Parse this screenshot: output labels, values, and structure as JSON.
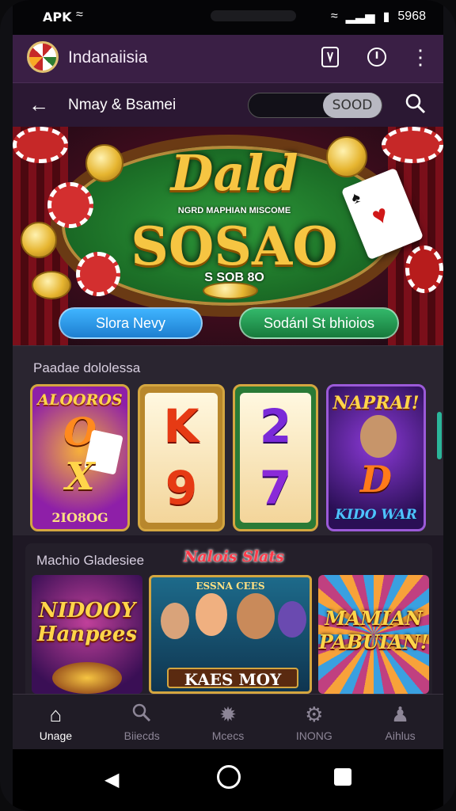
{
  "status_bar": {
    "carrier": "APK",
    "time": "5968"
  },
  "app_bar": {
    "title": "Indanaiisia"
  },
  "sub_bar": {
    "title": "Nmay & Bsamei",
    "pill_value": "SOOD"
  },
  "hero": {
    "title": "Dald",
    "tagline": "NGRD MAPHIAN MISCOME",
    "subtitle": "SOSAO",
    "note": "S SOB 8O",
    "button_left": "Slora Nevy",
    "button_right": "Sodánl St bhioios",
    "button_left_color": "#1e8fe0",
    "button_right_color": "#1f9a52"
  },
  "section1": {
    "label": "Paadae dololessa",
    "tiles": [
      {
        "top": "ALOOROS",
        "mid": "O",
        "mid2": "X",
        "bottom": "2IO8OG"
      },
      {
        "glyph_top": "K",
        "glyph_bottom": "9"
      },
      {
        "glyph_top": "2",
        "glyph_bottom": "7"
      },
      {
        "top": "NAPRAI!",
        "mid": "D",
        "bottom": "KIDO WAR"
      }
    ]
  },
  "section2": {
    "label": "Machio Gladesiee",
    "badge": "Nalois Slats",
    "tiles": [
      {
        "title": "NIDOOY Hanpees"
      },
      {
        "title": "KAES MOY",
        "banner": "ESSNA CEES"
      },
      {
        "title": "MAMIAN PABUIAN!"
      }
    ]
  },
  "bottom_nav": [
    {
      "label": "Unage",
      "icon": "home-icon",
      "active": true
    },
    {
      "label": "Biiecds",
      "icon": "search-icon",
      "active": false
    },
    {
      "label": "Mcecs",
      "icon": "gear-badge-icon",
      "active": false
    },
    {
      "label": "INONG",
      "icon": "settings-icon",
      "active": false
    },
    {
      "label": "Aihlus",
      "icon": "profile-icon",
      "active": false
    }
  ]
}
